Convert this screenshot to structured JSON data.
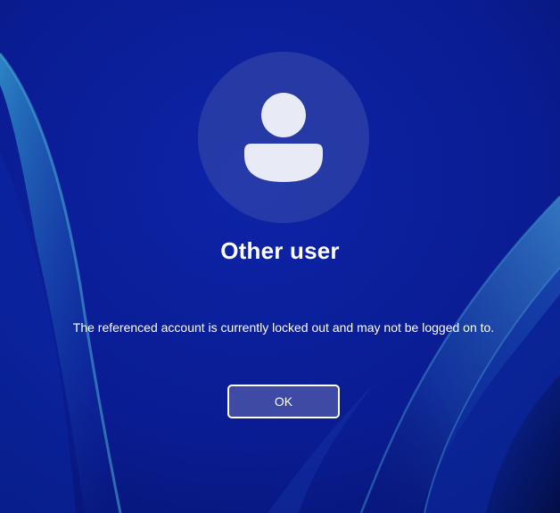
{
  "account": {
    "name": "Other user",
    "avatar_icon": "user-silhouette-icon"
  },
  "dialog": {
    "message": "The referenced account is currently locked out and may not be logged on to.",
    "ok_label": "OK"
  },
  "colors": {
    "background": "#0a1f9a",
    "accent_ribbon": "#2a6fb5",
    "text": "#ffffff"
  }
}
